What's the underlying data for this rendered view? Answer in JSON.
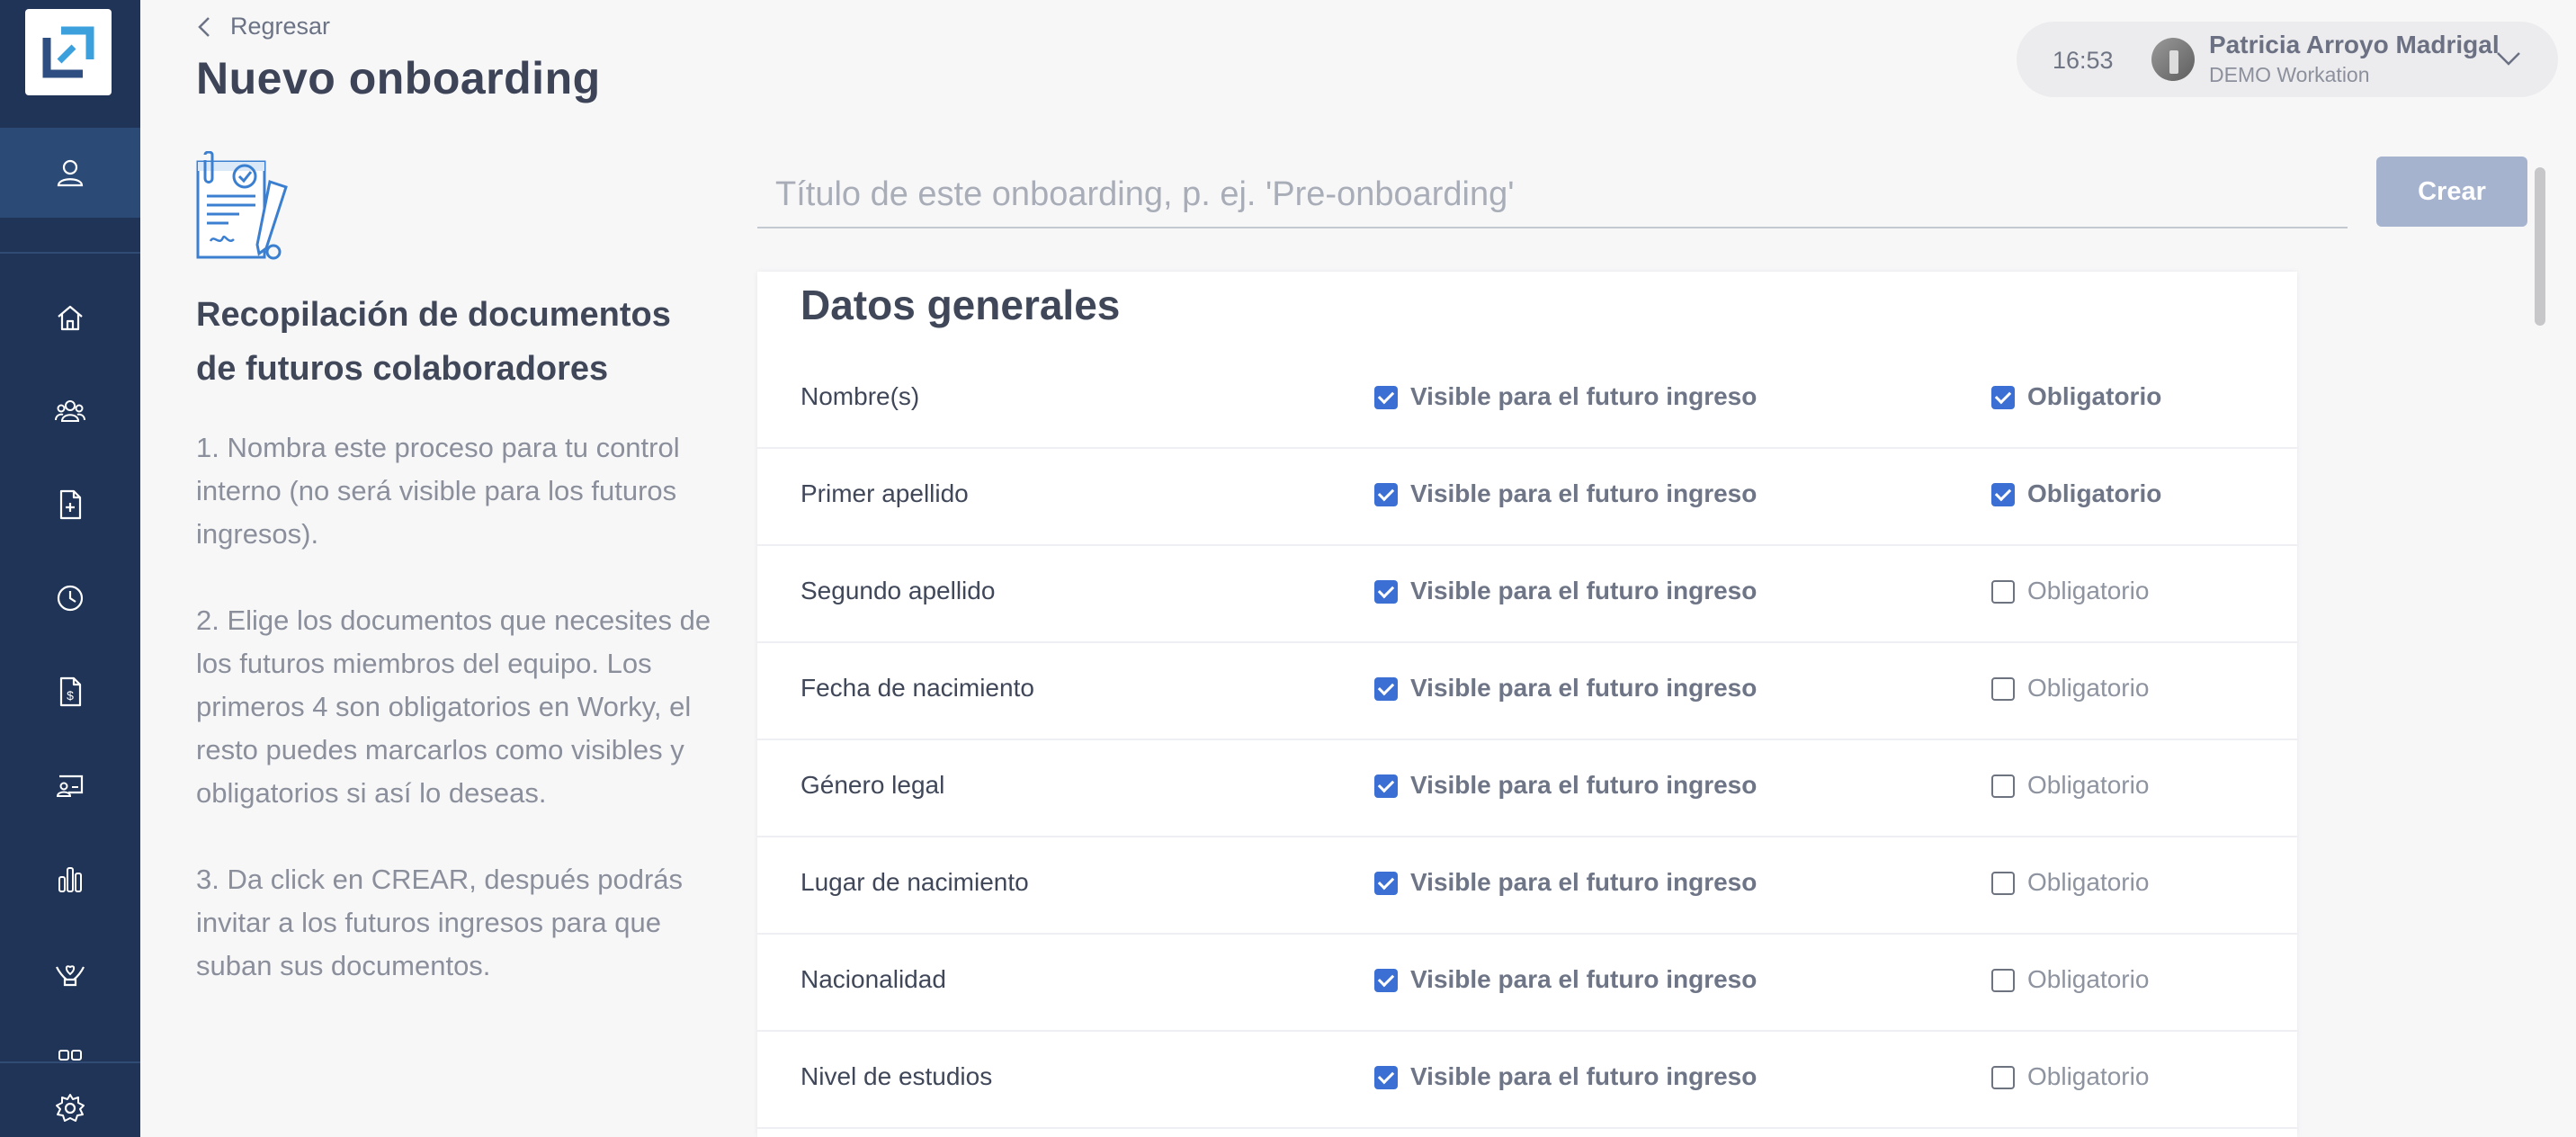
{
  "header": {
    "back_label": "Regresar",
    "title": "Nuevo onboarding"
  },
  "user": {
    "time": "16:53",
    "name": "Patricia Arroyo Madrigal",
    "organization": "DEMO Workation"
  },
  "sidebar": {
    "items": [
      {
        "icon": "home-icon"
      },
      {
        "icon": "people-icon"
      },
      {
        "icon": "document-add-icon"
      },
      {
        "icon": "clock-icon"
      },
      {
        "icon": "payroll-document-icon"
      },
      {
        "icon": "presentation-icon"
      },
      {
        "icon": "bar-chart-icon"
      },
      {
        "icon": "benefits-hands-icon"
      }
    ],
    "settings_icon": "gear-icon"
  },
  "info": {
    "heading": "Recopilación de documentos de futuros colaboradores",
    "step1": "1. Nombra este proceso para tu control interno (no será visible para los futuros ingresos).",
    "step2": "2. Elige los documentos que necesites de los futuros miembros del equipo. Los primeros 4 son obligatorios en Worky, el resto puedes marcarlos como visibles y obligatorios si así lo deseas.",
    "step3": "3. Da click en CREAR, después podrás invitar a los futuros ingresos para que suban sus documentos."
  },
  "form": {
    "title_placeholder": "Título de este onboarding, p. ej. 'Pre-onboarding'",
    "title_value": "",
    "create_label": "Crear"
  },
  "section": {
    "title": "Datos generales",
    "visible_label": "Visible para el futuro ingreso",
    "required_label": "Obligatorio",
    "rows": [
      {
        "label": "Nombre(s)",
        "visible": true,
        "required": true
      },
      {
        "label": "Primer apellido",
        "visible": true,
        "required": true
      },
      {
        "label": "Segundo apellido",
        "visible": true,
        "required": false
      },
      {
        "label": "Fecha de nacimiento",
        "visible": true,
        "required": false
      },
      {
        "label": "Género legal",
        "visible": true,
        "required": false
      },
      {
        "label": "Lugar de nacimiento",
        "visible": true,
        "required": false
      },
      {
        "label": "Nacionalidad",
        "visible": true,
        "required": false
      },
      {
        "label": "Nivel de estudios",
        "visible": true,
        "required": false
      }
    ]
  },
  "colors": {
    "sidebar": "#1f3457",
    "sidebar_active": "#2b4a76",
    "accent": "#3b6fd4",
    "button_disabled": "#a5b3cf"
  }
}
